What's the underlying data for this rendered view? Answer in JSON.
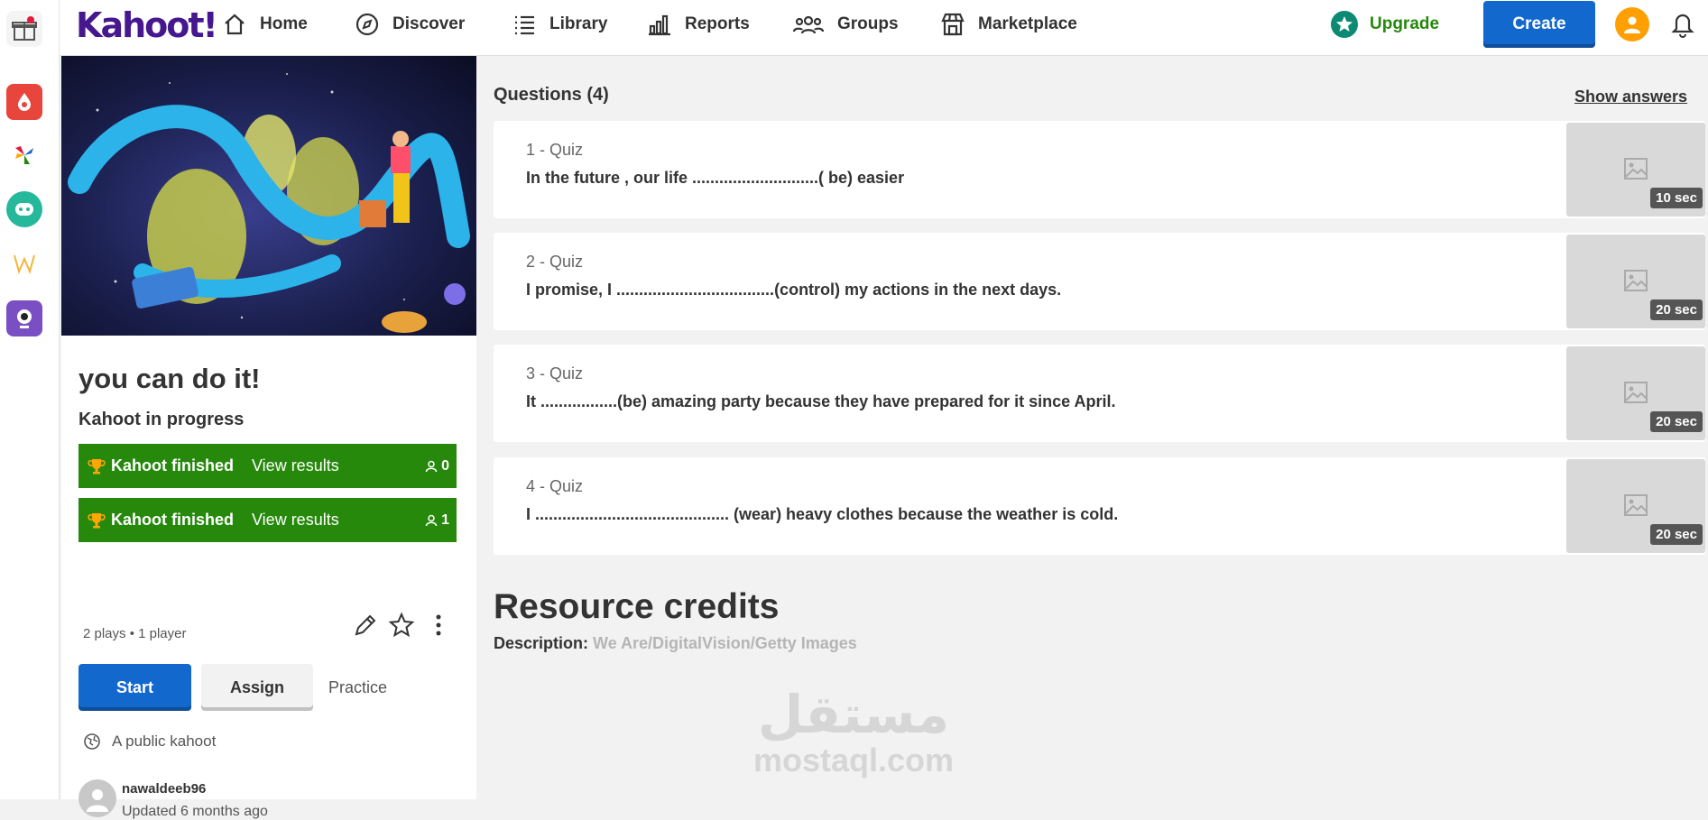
{
  "nav": {
    "logo": "Kahoot!",
    "items": [
      {
        "label": "Home",
        "icon": "home-icon"
      },
      {
        "label": "Discover",
        "icon": "compass-icon"
      },
      {
        "label": "Library",
        "icon": "list-icon"
      },
      {
        "label": "Reports",
        "icon": "bar-chart-icon"
      },
      {
        "label": "Groups",
        "icon": "users-icon"
      },
      {
        "label": "Marketplace",
        "icon": "store-icon"
      }
    ],
    "upgrade": "Upgrade",
    "create": "Create"
  },
  "kahoot": {
    "title": "you can do it!",
    "status": "Kahoot in progress",
    "sessions": [
      {
        "label": "Kahoot finished",
        "link": "View results",
        "players": "0"
      },
      {
        "label": "Kahoot finished",
        "link": "View results",
        "players": "1"
      }
    ],
    "plays": "2 plays • 1 player",
    "start": "Start",
    "assign": "Assign",
    "practice": "Practice",
    "visibility": "A public kahoot",
    "author": "nawaldeeb96",
    "updated": "Updated 6 months ago"
  },
  "questions": {
    "heading": "Questions (4)",
    "show_answers": "Show answers",
    "items": [
      {
        "num": "1 - Quiz",
        "text": "In the future , our life ............................( be) easier",
        "time": "10 sec"
      },
      {
        "num": "2 - Quiz",
        "text": "I promise, I ...................................(control) my actions in the next days.",
        "time": "20 sec"
      },
      {
        "num": "3 - Quiz",
        "text": "It .................(be) amazing party because they have prepared for it since April.",
        "time": "20 sec"
      },
      {
        "num": "4 - Quiz",
        "text": "I ........................................... (wear) heavy clothes because the weather is cold.",
        "time": "20 sec"
      }
    ]
  },
  "credits": {
    "title": "Resource credits",
    "desc_label": "Description:",
    "desc_value": "We Are/DigitalVision/Getty Images"
  },
  "watermark": {
    "arabic": "مستقل",
    "latin": "mostaql.com"
  }
}
